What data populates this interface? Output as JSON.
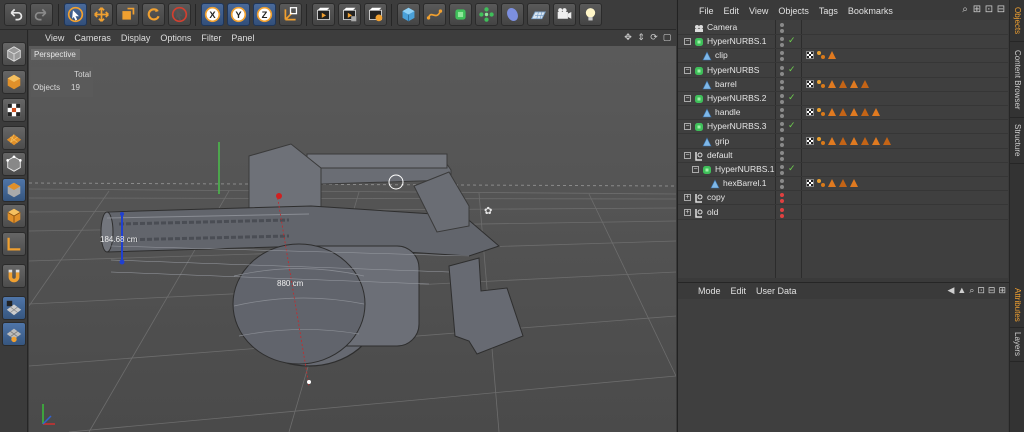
{
  "viewport": {
    "menu": [
      "View",
      "Cameras",
      "Display",
      "Options",
      "Filter",
      "Panel"
    ],
    "camera_label": "Perspective",
    "hud": {
      "total_label": "Total",
      "objects_label": "Objects",
      "objects_count": "19"
    },
    "dim_width": "184.68 cm",
    "dim_length": "880 cm"
  },
  "object_manager": {
    "menu": [
      "File",
      "Edit",
      "View",
      "Objects",
      "Tags",
      "Bookmarks"
    ],
    "rows": [
      {
        "name": "Camera",
        "indent": 0,
        "type": "camera",
        "check": false,
        "tags": []
      },
      {
        "name": "HyperNURBS.1",
        "indent": 0,
        "type": "hypernurbs",
        "check": true,
        "tags": []
      },
      {
        "name": "clip",
        "indent": 1,
        "type": "polygon",
        "check": false,
        "tags": [
          "checker",
          "dots",
          "tri"
        ]
      },
      {
        "name": "HyperNURBS",
        "indent": 0,
        "type": "hypernurbs",
        "check": true,
        "tags": []
      },
      {
        "name": "barrel",
        "indent": 1,
        "type": "polygon",
        "check": false,
        "tags": [
          "checker",
          "dots",
          "tri",
          "tri",
          "tri",
          "tri"
        ]
      },
      {
        "name": "HyperNURBS.2",
        "indent": 0,
        "type": "hypernurbs",
        "check": true,
        "tags": []
      },
      {
        "name": "handle",
        "indent": 1,
        "type": "polygon",
        "check": false,
        "tags": [
          "checker",
          "dots",
          "tri",
          "tri",
          "tri",
          "tri",
          "tri"
        ]
      },
      {
        "name": "HyperNURBS.3",
        "indent": 0,
        "type": "hypernurbs",
        "check": true,
        "tags": []
      },
      {
        "name": "grip",
        "indent": 1,
        "type": "polygon",
        "check": false,
        "tags": [
          "checker",
          "dots",
          "tri",
          "tri",
          "tri",
          "tri",
          "tri",
          "tri"
        ]
      },
      {
        "name": "default",
        "indent": 0,
        "type": "null",
        "check": false,
        "tags": []
      },
      {
        "name": "HyperNURBS.1",
        "indent": 1,
        "type": "hypernurbs",
        "check": true,
        "tags": []
      },
      {
        "name": "hexBarrel.1",
        "indent": 2,
        "type": "polygon",
        "check": false,
        "tags": [
          "checker",
          "dots",
          "tri",
          "tri",
          "tri"
        ]
      },
      {
        "name": "copy",
        "indent": 0,
        "type": "null",
        "check": false,
        "tags": []
      },
      {
        "name": "old",
        "indent": 0,
        "type": "null",
        "check": false,
        "tags": []
      }
    ]
  },
  "attributes": {
    "menu": [
      "Mode",
      "Edit",
      "User Data"
    ]
  },
  "side_tabs": [
    {
      "label": "Objects",
      "active": true
    },
    {
      "label": "Content Browser",
      "active": false
    },
    {
      "label": "Structure",
      "active": false
    },
    {
      "label": "Attributes",
      "active": true
    },
    {
      "label": "Layers",
      "active": false
    }
  ],
  "toolbar": {
    "icons": [
      "undo-icon",
      "redo-icon",
      "live-selection-icon",
      "move-icon",
      "scale-icon",
      "rotate-icon",
      "recent-tool-icon",
      "x-axis-lock-icon",
      "y-axis-lock-icon",
      "z-axis-lock-icon",
      "coordinate-system-icon",
      "render-view-icon",
      "render-picture-viewer-icon",
      "render-settings-icon",
      "cube-icon",
      "spline-pen-icon",
      "nurbs-icon",
      "array-icon",
      "deformer-icon",
      "floor-icon",
      "camera-icon",
      "light-icon"
    ]
  },
  "colors": {
    "accent": "#f0a030",
    "active_blue": "#3d5f8f",
    "check_green": "#6fcf4f",
    "tag_orange": "#e07a20"
  }
}
